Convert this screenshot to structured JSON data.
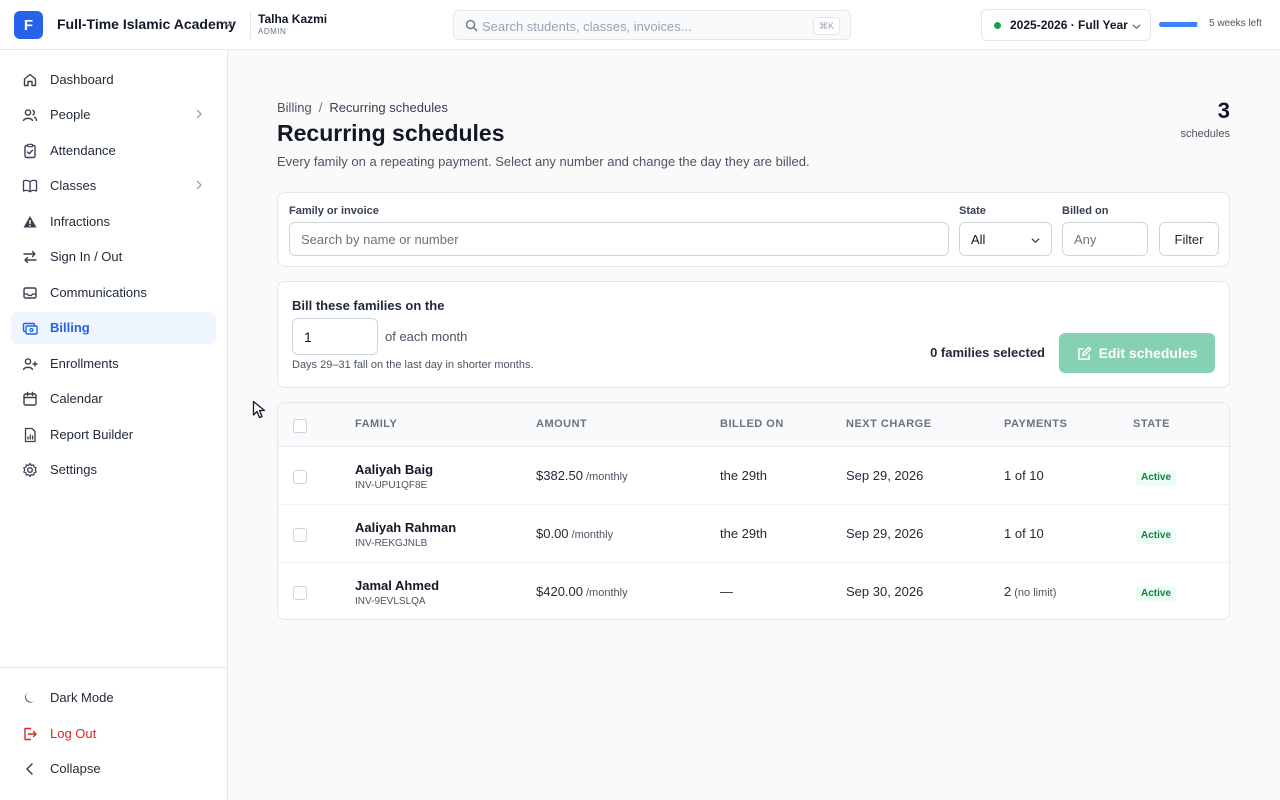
{
  "topbar": {
    "logo_letter": "F",
    "org_name": "Full-Time Islamic Academy",
    "user_name": "Talha Kazmi",
    "user_role": "ADMIN",
    "search_placeholder": "Search students, classes, invoices...",
    "search_shortcut": "⌘K",
    "school_year": "2025-2026 · Full Year",
    "term_progress": 0.95,
    "weeks_left": "5 weeks left"
  },
  "sidebar": {
    "items": [
      {
        "label": "Dashboard",
        "icon": "home-icon"
      },
      {
        "label": "People",
        "icon": "users-icon"
      },
      {
        "label": "Attendance",
        "icon": "clipboard-icon"
      },
      {
        "label": "Classes",
        "icon": "book-icon"
      },
      {
        "label": "Infractions",
        "icon": "warning-icon"
      },
      {
        "label": "Sign In / Out",
        "icon": "swap-icon"
      },
      {
        "label": "Communications",
        "icon": "inbox-icon"
      },
      {
        "label": "Billing",
        "icon": "billing-icon"
      },
      {
        "label": "Enrollments",
        "icon": "user-plus-icon"
      },
      {
        "label": "Calendar",
        "icon": "calendar-icon"
      },
      {
        "label": "Report Builder",
        "icon": "report-icon"
      },
      {
        "label": "Settings",
        "icon": "gear-icon"
      }
    ],
    "footer": {
      "dark_mode": "Dark Mode",
      "logout": "Log Out",
      "collapse": "Collapse"
    }
  },
  "page": {
    "breadcrumb_root": "Billing",
    "breadcrumb_sep": "/",
    "breadcrumb_current": "Recurring schedules",
    "title": "Recurring schedules",
    "subtitle": "Every family on a repeating payment. Select any number and change the day they are billed.",
    "count": "3",
    "count_label": "schedules"
  },
  "filters": {
    "family_label": "Family or invoice",
    "family_placeholder": "Search by name or number",
    "state_label": "State",
    "state_value": "All",
    "billed_label": "Billed on",
    "billed_placeholder": "Any",
    "filter_button": "Filter"
  },
  "bill_panel": {
    "title": "Bill these families on the",
    "day_value": "1",
    "suffix": "of each month",
    "hint": "Days 29–31 fall on the last day in shorter months.",
    "selected_text": "0 families selected",
    "edit_button": "Edit schedules"
  },
  "table": {
    "headers": {
      "family": "FAMILY",
      "amount": "AMOUNT",
      "billed_on": "BILLED ON",
      "next_charge": "NEXT CHARGE",
      "payments": "PAYMENTS",
      "state": "STATE"
    },
    "rows": [
      {
        "name": "Aaliyah Baig",
        "invoice": "INV-UPU1QF8E",
        "amount": "$382.50",
        "period": "/monthly",
        "billed_on": "the 29th",
        "next_charge": "Sep 29, 2026",
        "payments": "1 of 10",
        "payments_note": "",
        "state": "Active"
      },
      {
        "name": "Aaliyah Rahman",
        "invoice": "INV-REKGJNLB",
        "amount": "$0.00",
        "period": "/monthly",
        "billed_on": "the 29th",
        "next_charge": "Sep 29, 2026",
        "payments": "1 of 10",
        "payments_note": "",
        "state": "Active"
      },
      {
        "name": "Jamal Ahmed",
        "invoice": "INV-9EVLSLQA",
        "amount": "$420.00",
        "period": "/monthly",
        "billed_on": "—",
        "next_charge": "Sep 30, 2026",
        "payments": "2",
        "payments_note": "(no limit)",
        "state": "Active"
      }
    ]
  },
  "colors": {
    "accent": "#2563eb",
    "active_bg": "#eff6ff",
    "success": "#16a34a",
    "edit_disabled": "#86d1b1",
    "danger": "#dc2626"
  }
}
